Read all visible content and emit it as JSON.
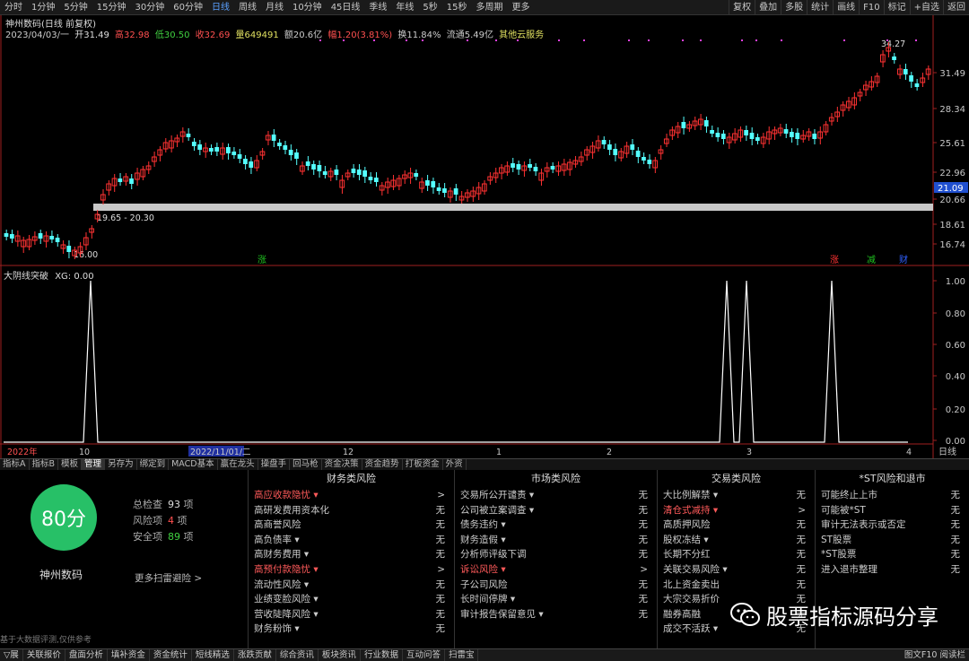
{
  "toolbar": {
    "timeframes": [
      "分时",
      "1分钟",
      "5分钟",
      "15分钟",
      "30分钟",
      "60分钟",
      "日线",
      "周线",
      "月线",
      "10分钟",
      "45日线",
      "季线",
      "年线",
      "5秒",
      "15秒",
      "多周期",
      "更多"
    ],
    "active_index": 6,
    "right_buttons": [
      "复权",
      "叠加",
      "多股",
      "统计",
      "画线",
      "F10",
      "标记",
      "+自选",
      "返回"
    ]
  },
  "stock_header": {
    "title": "神州数码(日线 前复权)",
    "date": "2023/04/03/一",
    "open": "开31.49",
    "high": "高32.98",
    "low": "低30.50",
    "close": "收32.69",
    "volume": "量649491",
    "amount": "额20.6亿",
    "change": "幅1.20(3.81%)",
    "turnover": "换11.84%",
    "float": "流通5.49亿",
    "service": "其他云服务"
  },
  "price_axis": [
    "31.49",
    "28.34",
    "25.61",
    "22.96",
    "20.66",
    "18.61",
    "16.74"
  ],
  "current_price": "21.09",
  "annotations": {
    "max_price": "34.27",
    "min_price": "16.00",
    "band": "19.65 - 20.30"
  },
  "markers": [
    "涨",
    "涨",
    "减",
    "财"
  ],
  "indicator": {
    "title": "大阴线突破",
    "value": "XG: 0.00",
    "axis": [
      "1.00",
      "0.80",
      "0.60",
      "0.40",
      "0.20",
      "0.00"
    ]
  },
  "time_axis": [
    "2022年",
    "10",
    "2022/11/01/二",
    "12",
    "1",
    "2",
    "3",
    "4"
  ],
  "period_label": "日线",
  "tabs": [
    "指标A",
    "指标B",
    "模板",
    "管理",
    "另存为",
    "绑定到",
    "MACD基本",
    "赢在龙头",
    "操盘手",
    "回马枪",
    "资金决策",
    "资金趋势",
    "打板资金",
    "外资"
  ],
  "active_tab": 3,
  "score": {
    "value": "80分",
    "name": "神州数码",
    "total_label": "总检查",
    "total": "93",
    "total_unit": "项",
    "risk_label": "风险项",
    "risk": "4",
    "risk_unit": "项",
    "safe_label": "安全项",
    "safe": "89",
    "safe_unit": "项",
    "more": "更多扫雷避险 >"
  },
  "risk_columns": [
    {
      "title": "财务类风险",
      "items": [
        {
          "label": "高应收款隐忧 ▾",
          "value": ">",
          "warn": true
        },
        {
          "label": "高研发费用资本化",
          "value": "无"
        },
        {
          "label": "高商誉风险",
          "value": "无"
        },
        {
          "label": "高负债率 ▾",
          "value": "无"
        },
        {
          "label": "高财务费用 ▾",
          "value": "无"
        },
        {
          "label": "高预付款隐忧 ▾",
          "value": ">",
          "warn": true
        },
        {
          "label": "流动性风险 ▾",
          "value": "无"
        },
        {
          "label": "业绩变脸风险 ▾",
          "value": "无"
        },
        {
          "label": "营收陡降风险 ▾",
          "value": "无"
        },
        {
          "label": "财务粉饰 ▾",
          "value": "无"
        }
      ]
    },
    {
      "title": "市场类风险",
      "items": [
        {
          "label": "交易所公开谴责 ▾",
          "value": "无"
        },
        {
          "label": "公司被立案调查 ▾",
          "value": "无"
        },
        {
          "label": "债务违约 ▾",
          "value": "无"
        },
        {
          "label": "财务造假 ▾",
          "value": "无"
        },
        {
          "label": "分析师评级下调",
          "value": "无"
        },
        {
          "label": "诉讼风险 ▾",
          "value": ">",
          "warn": true
        },
        {
          "label": "子公司风险",
          "value": "无"
        },
        {
          "label": "长时间停牌 ▾",
          "value": "无"
        },
        {
          "label": "审计报告保留意见 ▾",
          "value": "无"
        }
      ]
    },
    {
      "title": "交易类风险",
      "items": [
        {
          "label": "大比例解禁 ▾",
          "value": "无"
        },
        {
          "label": "清仓式减持 ▾",
          "value": ">",
          "warn": true
        },
        {
          "label": "高质押风险",
          "value": "无"
        },
        {
          "label": "股权冻结 ▾",
          "value": "无"
        },
        {
          "label": "长期不分红",
          "value": "无"
        },
        {
          "label": "关联交易风险 ▾",
          "value": "无"
        },
        {
          "label": "北上资金卖出",
          "value": "无"
        },
        {
          "label": "大宗交易折价",
          "value": "无"
        },
        {
          "label": "融券高融",
          "value": "无"
        },
        {
          "label": "成交不活跃 ▾",
          "value": "无"
        }
      ]
    },
    {
      "title": "*ST风险和退市",
      "items": [
        {
          "label": "可能终止上市",
          "value": "无"
        },
        {
          "label": "可能被*ST",
          "value": "无"
        },
        {
          "label": "审计无法表示或否定",
          "value": "无"
        },
        {
          "label": "ST股票",
          "value": "无"
        },
        {
          "label": "*ST股票",
          "value": "无"
        },
        {
          "label": "进入退市整理",
          "value": "无"
        }
      ]
    }
  ],
  "disclaimer": "基于大数据评测,仅供参考",
  "watermark": "股票指标源码分享",
  "status_bar": [
    "▽展",
    "关联报价",
    "盘面分析",
    "填补资金",
    "资金统计",
    "短线精选",
    "涨跌贡献",
    "综合资讯",
    "板块资讯",
    "行业数据",
    "互动问答",
    "扫雷宝"
  ],
  "status_right": "图文F10 阅读栏",
  "colors": {
    "up": "#ff3232",
    "down": "#54ffff",
    "highlight_band": "#c8c8c8",
    "score": "#27c067"
  }
}
